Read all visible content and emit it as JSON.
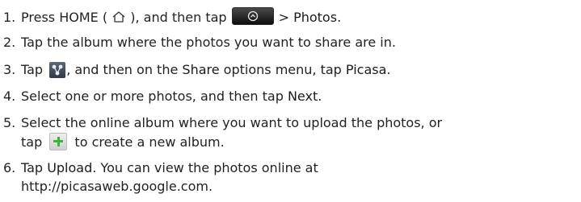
{
  "steps": [
    {
      "num": "1.",
      "pre": "Press HOME (",
      "mid": "), and then tap",
      "tail_sep": ">",
      "tail": "Photos",
      "end": "."
    },
    {
      "num": "2.",
      "text": "Tap the album where the photos you want to share are in."
    },
    {
      "num": "3.",
      "pre": "Tap",
      "mid": ", and then on the",
      "share": "Share",
      "mid2": "options menu, tap",
      "picasa": "Picasa",
      "end": "."
    },
    {
      "num": "4.",
      "pre": "Select one or more photos, and then tap",
      "next": "Next",
      "end": "."
    },
    {
      "num": "5.",
      "line1": "Select the online album where you want to upload the photos, or",
      "pre2": "tap",
      "post2": "to create a new album."
    },
    {
      "num": "6.",
      "pre": "Tap",
      "upload": "Upload",
      "post": ". You can view the photos online at",
      "line2": "http://picasaweb.google.com."
    }
  ],
  "icons": {
    "home": "home-icon",
    "all_apps": "all-apps-button-icon",
    "share": "share-icon",
    "add": "plus-icon"
  }
}
